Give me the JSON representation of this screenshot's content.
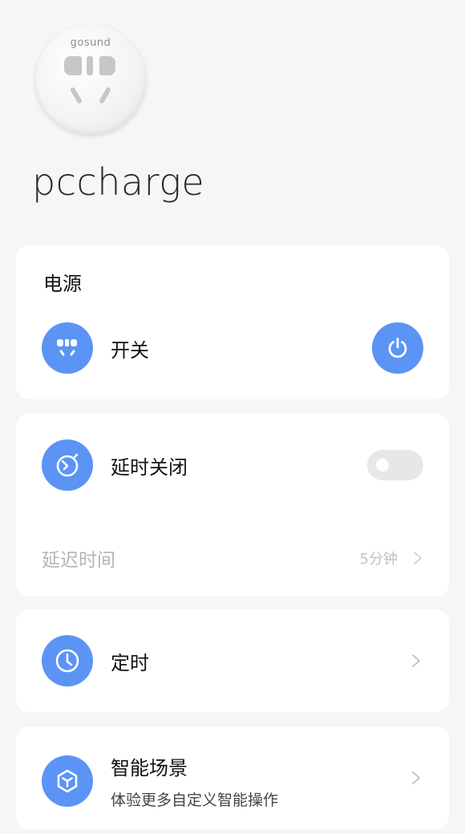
{
  "device": {
    "image_brand": "gosund",
    "name": "pccharge"
  },
  "power": {
    "section_title": "电源",
    "switch_label": "开关",
    "switch_on": false
  },
  "delay": {
    "label": "延时关闭",
    "toggle_on": false,
    "time_label": "延迟时间",
    "time_value": "5分钟"
  },
  "timer": {
    "label": "定时"
  },
  "scene": {
    "title": "智能场景",
    "subtitle": "体验更多自定义智能操作"
  },
  "colors": {
    "accent": "#5b94f5",
    "background": "#f6f6f6",
    "card": "#ffffff",
    "muted_text": "#b5b5b5",
    "toggle_off": "#e7e7e7"
  },
  "icons": {
    "power_row": "socket-icon",
    "power_button": "power-icon",
    "delay": "stopwatch-icon",
    "timer": "clock-icon",
    "scene": "scene-cube-icon",
    "chevron": "chevron-right-icon"
  }
}
